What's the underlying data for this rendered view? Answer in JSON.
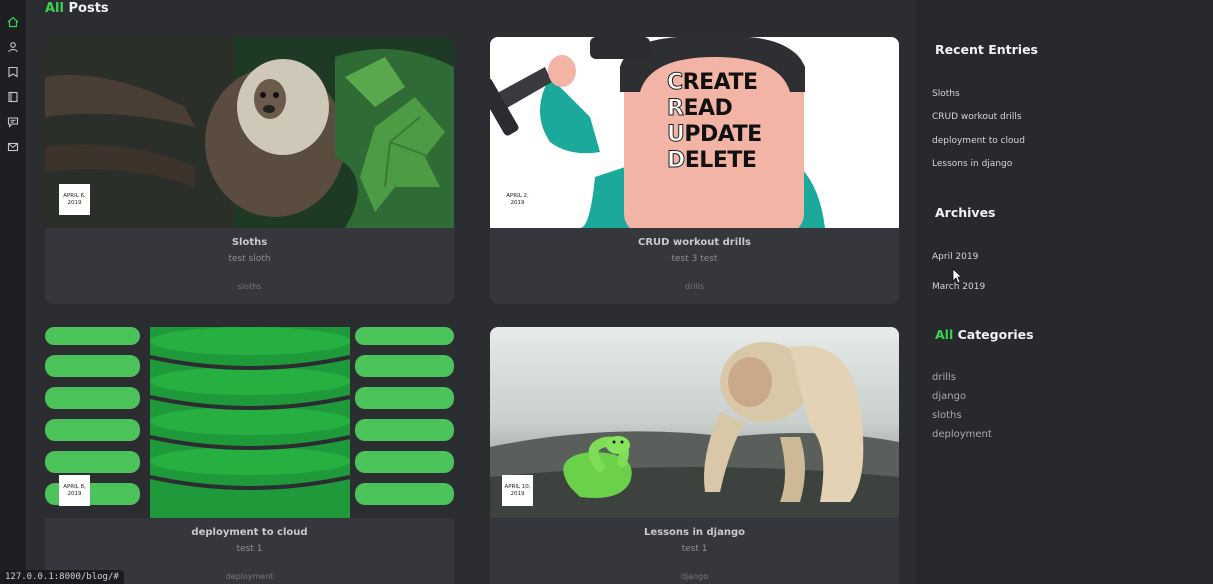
{
  "nav": {
    "icons": [
      "home-icon",
      "user-icon",
      "bookmark-icon",
      "book-icon",
      "chat-icon",
      "mail-icon"
    ],
    "accent": "#39d353"
  },
  "main": {
    "title_accent": "All",
    "title_rest": " Posts"
  },
  "posts": [
    {
      "title": "Sloths",
      "desc": "test sloth",
      "tag": "sloths",
      "date_line1": "APRIL 6,",
      "date_line2": "2019"
    },
    {
      "title": "CRUD workout drills",
      "desc": "test 3 test",
      "tag": "drills",
      "date_line1": "APRIL 2,",
      "date_line2": "2019"
    },
    {
      "title": "deployment to cloud",
      "desc": "test 1",
      "tag": "deployment",
      "date_line1": "APRIL 8,",
      "date_line2": "2019"
    },
    {
      "title": "Lessons in django",
      "desc": "test 1",
      "tag": "django",
      "date_line1": "APRIL 10,",
      "date_line2": "2019"
    }
  ],
  "crud_words": [
    {
      "first": "C",
      "rest": "REATE"
    },
    {
      "first": "R",
      "rest": "EAD"
    },
    {
      "first": "U",
      "rest": "PDATE"
    },
    {
      "first": "D",
      "rest": "ELETE"
    }
  ],
  "sidebar": {
    "recent_heading": "Recent Entries",
    "recent": [
      "Sloths",
      "CRUD workout drills",
      "deployment to cloud",
      "Lessons in django"
    ],
    "archives_heading": "Archives",
    "archives": [
      "April 2019",
      "March 2019"
    ],
    "categories_heading_accent": "All",
    "categories_heading_rest": " Categories",
    "categories": [
      "drills",
      "django",
      "sloths",
      "deployment"
    ]
  },
  "status_url": "127.0.0.1:8000/blog/#"
}
